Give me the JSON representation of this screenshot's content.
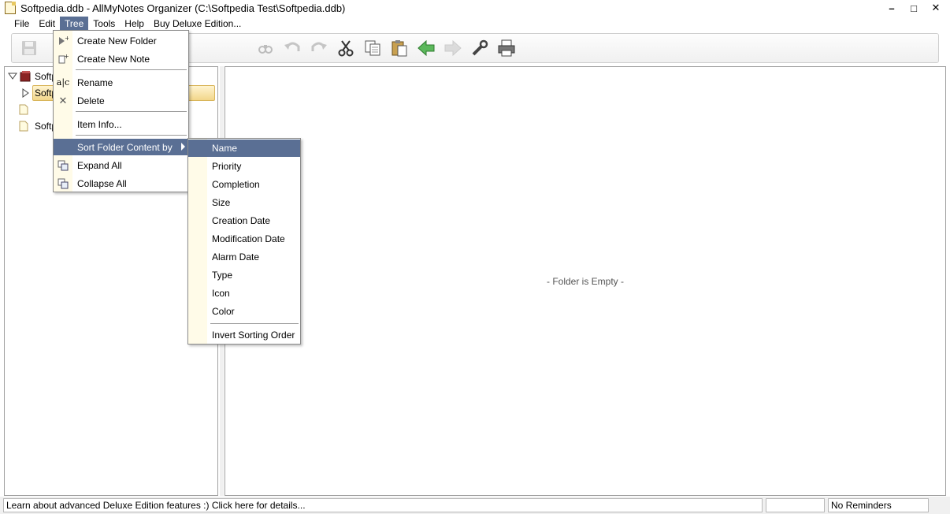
{
  "window": {
    "title": "Softpedia.ddb - AllMyNotes Organizer (C:\\Softpedia Test\\Softpedia.ddb)",
    "minimize": "–",
    "maximize": "□",
    "close": "✕"
  },
  "menubar": {
    "items": [
      {
        "label": "File"
      },
      {
        "label": "Edit"
      },
      {
        "label": "Tree"
      },
      {
        "label": "Tools"
      },
      {
        "label": "Help"
      },
      {
        "label": "Buy Deluxe Edition..."
      }
    ]
  },
  "toolbar": {
    "buttons": [
      "save-icon",
      "find-icon",
      "undo-icon",
      "redo-icon",
      "cut-icon",
      "copy-icon",
      "paste-icon",
      "back-arrow-icon",
      "forward-arrow-icon",
      "wrench-icon",
      "print-icon"
    ]
  },
  "tree": {
    "root_label": "Softp",
    "child1_label": "Softp",
    "child3_label": "Softp"
  },
  "tree_menu": {
    "create_folder": "Create New Folder",
    "create_note": "Create New Note",
    "rename": "Rename",
    "delete": "Delete",
    "item_info": "Item Info...",
    "sort_by": "Sort Folder Content by",
    "expand_all": "Expand All",
    "collapse_all": "Collapse All"
  },
  "sort_submenu": {
    "items": [
      {
        "label": "Name"
      },
      {
        "label": "Priority"
      },
      {
        "label": "Completion"
      },
      {
        "label": "Size"
      },
      {
        "label": "Creation Date"
      },
      {
        "label": "Modification Date"
      },
      {
        "label": "Alarm Date"
      },
      {
        "label": "Type"
      },
      {
        "label": "Icon"
      },
      {
        "label": "Color"
      },
      {
        "label": "Invert Sorting Order"
      }
    ]
  },
  "content": {
    "empty_message": "- Folder is Empty -"
  },
  "statusbar": {
    "info": "Learn about advanced Deluxe Edition features :) Click here for details...",
    "middle": "",
    "reminders": "No Reminders"
  },
  "colors": {
    "menu_highlight": "#5a6f94",
    "gutter": "#fffbe8",
    "selection": "#f2d68a"
  }
}
